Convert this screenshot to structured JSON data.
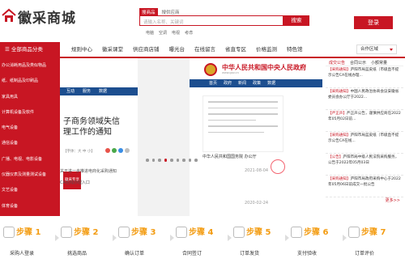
{
  "logo": {
    "text": "徽采商城"
  },
  "search": {
    "tabs": [
      "搜商品",
      "搜供应商"
    ],
    "placeholder": "请输入名称、关键词",
    "button": "搜索",
    "hot_words": [
      "电脑",
      "空调",
      "电视",
      "考虑"
    ]
  },
  "header": {
    "login_label": "登录"
  },
  "nav": {
    "category_label": "全部商品分类",
    "items": [
      "规则中心",
      "徽采课堂",
      "供应商店铺",
      "曝光台",
      "在线留言",
      "省直专区",
      "价格监测",
      "特色馆"
    ],
    "region": "合作区域"
  },
  "categories": [
    "办公消耗用品及类似物品",
    "纸、纸制品及印刷品",
    "家具用具",
    "计算机设备及软件",
    "电气设备",
    "通信设备",
    "广播、电视、电影设备",
    "仪器仪表及测量测试设备",
    "文艺设备",
    "体育设备",
    "图书档案"
  ],
  "banner": {
    "left_doc": {
      "tabs": [
        "互动",
        "服务",
        "数据"
      ],
      "title": "子商务领域失信\n理工作的通知",
      "meta": "【字体：大 中 小】",
      "badge": "徽采专享",
      "line1": "关于进一步推进电商化采购通知",
      "line2": "CA在线办理入口",
      "date1": "2021-08-04",
      "date2": "2020-02-24"
    },
    "right_doc": {
      "title": "中华人民共和国中央人民政府",
      "subtitle": "www.gov.cn",
      "nav": [
        "首页",
        "政府",
        "新闻",
        "政策",
        "数据"
      ],
      "footer": "中华人民共和国国务院 办公厅"
    },
    "slide_index": 3,
    "slide_count": 9
  },
  "notices": {
    "tabs": [
      "成交公告",
      "合同公示",
      "小额常量"
    ],
    "items": [
      {
        "tag": "【采购通知】",
        "text": "庐阳市局蓝皮纸（市级直不提示公告CA在线办理..."
      },
      {
        "tag": "【采购通知】",
        "text": "中国人民政治协商会议安徽省委员会办公厅于2022..."
      },
      {
        "tag": "【严正声】",
        "text": "严正声公告，谨慎供应商在2022年05月02日前..."
      },
      {
        "tag": "【采购通知】",
        "text": "庐阳市局蓝皮纸（市级直不提示公告CA在线..."
      },
      {
        "tag": "【公告】",
        "text": "庐阳市局中级人民法院采购服务，公告于2022年05月03日"
      },
      {
        "tag": "【采购通知】",
        "text": "庐阳市局政府采购中心于2022年05月06日前成交一批公告"
      }
    ],
    "more": "更多>>"
  },
  "steps": [
    {
      "num": "步骤 1",
      "label": "采购人登录"
    },
    {
      "num": "步骤 2",
      "label": "挑选商品"
    },
    {
      "num": "步骤 3",
      "label": "确认订单"
    },
    {
      "num": "步骤 4",
      "label": "合同签订"
    },
    {
      "num": "步骤 5",
      "label": "订单发货"
    },
    {
      "num": "步骤 6",
      "label": "支付验收"
    },
    {
      "num": "步骤 7",
      "label": "订单评价"
    }
  ],
  "colors": {
    "brand": "#c81623",
    "step": "#f39c12",
    "gov_blue": "#1c4e8f"
  }
}
